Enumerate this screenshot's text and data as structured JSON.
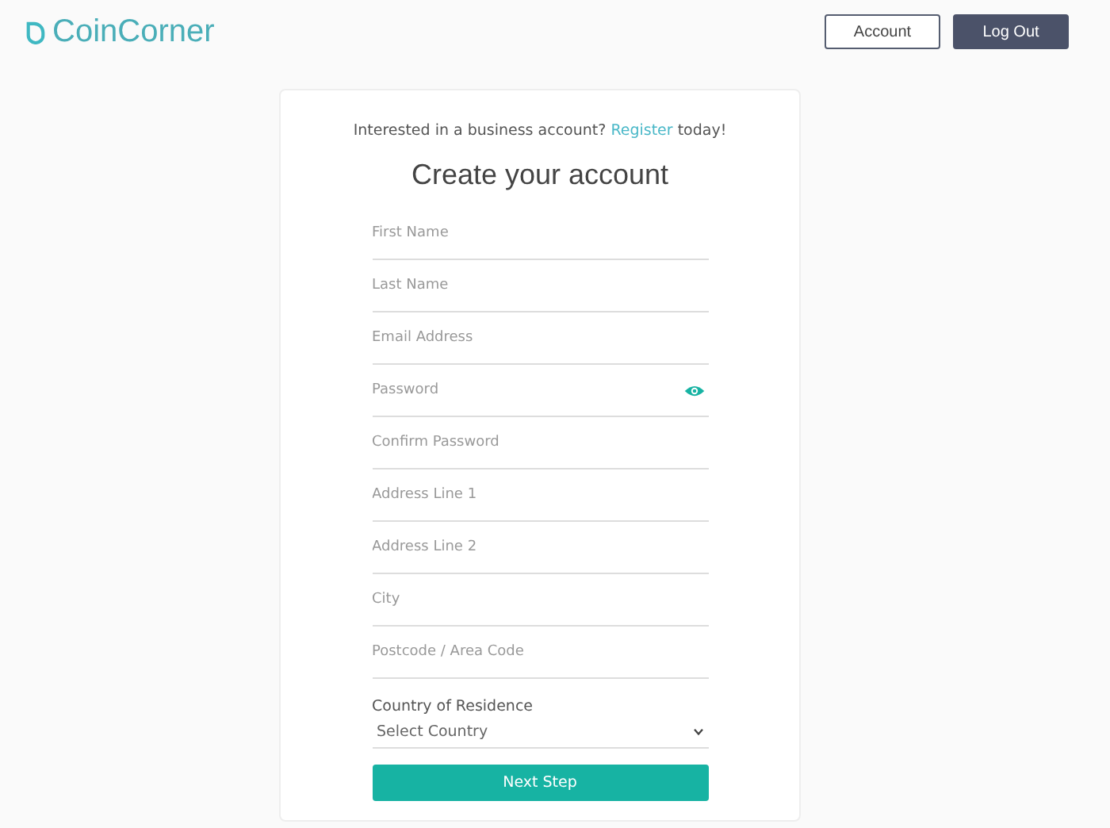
{
  "header": {
    "logo": "CoinCorner",
    "buttons": [
      {
        "label": "Account",
        "kind": "outline"
      },
      {
        "label": "Log Out",
        "kind": "solid"
      }
    ]
  },
  "card": {
    "promo": {
      "before": "Interested in a business account?",
      "link": "Register",
      "after": "today!"
    },
    "title": "Create your account",
    "fields": [
      {
        "placeholder": "First Name",
        "kind": "text"
      },
      {
        "placeholder": "Last Name",
        "kind": "text"
      },
      {
        "placeholder": "Email Address",
        "kind": "text"
      },
      {
        "placeholder": "Password",
        "kind": "password"
      },
      {
        "placeholder": "Confirm Password",
        "kind": "text"
      },
      {
        "placeholder": "Address Line 1",
        "kind": "text"
      },
      {
        "placeholder": "Address Line 2",
        "kind": "text"
      },
      {
        "placeholder": "City",
        "kind": "text"
      },
      {
        "placeholder": "Postcode / Area Code",
        "kind": "text"
      }
    ],
    "country": {
      "label": "Country of Residence",
      "value": "Select Country"
    },
    "submit": "Next Step"
  }
}
